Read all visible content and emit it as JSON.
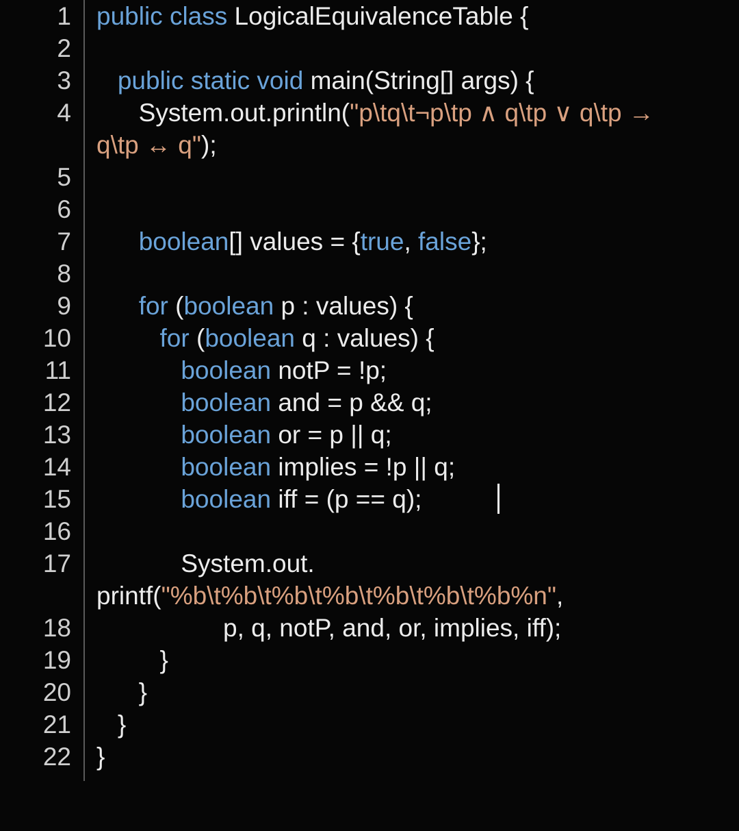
{
  "editor": {
    "colors": {
      "background": "#060606",
      "keyword": "#6aa3d9",
      "string": "#d9a07f",
      "text": "#ececec",
      "line_number": "#cfcfcf"
    },
    "lines": [
      {
        "num": "1",
        "segments": [
          {
            "t": "public class",
            "c": "kw"
          },
          {
            "t": " LogicalEquivalenceTable {",
            "c": "plain"
          }
        ]
      },
      {
        "num": "2",
        "segments": []
      },
      {
        "num": "3",
        "segments": [
          {
            "t": "   ",
            "c": "plain"
          },
          {
            "t": "public static void",
            "c": "kw"
          },
          {
            "t": " main(String[] args) {",
            "c": "plain"
          }
        ]
      },
      {
        "num": "4",
        "segments": [
          {
            "t": "      System.out.println(",
            "c": "plain"
          },
          {
            "t": "\"p\\tq\\t¬p\\tp ∧ q\\tp ∨ q\\tp →",
            "c": "str"
          }
        ]
      },
      {
        "num": "",
        "segments": [
          {
            "t": "q\\tp ↔ q\"",
            "c": "str"
          },
          {
            "t": ");",
            "c": "plain"
          }
        ]
      },
      {
        "num": "5",
        "segments": []
      },
      {
        "num": "6",
        "segments": []
      },
      {
        "num": "7",
        "segments": [
          {
            "t": "      ",
            "c": "plain"
          },
          {
            "t": "boolean",
            "c": "kw"
          },
          {
            "t": "[] values = {",
            "c": "plain"
          },
          {
            "t": "true",
            "c": "kw"
          },
          {
            "t": ", ",
            "c": "plain"
          },
          {
            "t": "false",
            "c": "kw"
          },
          {
            "t": "};",
            "c": "plain"
          }
        ]
      },
      {
        "num": "8",
        "segments": []
      },
      {
        "num": "9",
        "segments": [
          {
            "t": "      ",
            "c": "plain"
          },
          {
            "t": "for",
            "c": "kw"
          },
          {
            "t": " (",
            "c": "plain"
          },
          {
            "t": "boolean",
            "c": "kw"
          },
          {
            "t": " p : values) {",
            "c": "plain"
          }
        ]
      },
      {
        "num": "10",
        "segments": [
          {
            "t": "         ",
            "c": "plain"
          },
          {
            "t": "for",
            "c": "kw"
          },
          {
            "t": " (",
            "c": "plain"
          },
          {
            "t": "boolean",
            "c": "kw"
          },
          {
            "t": " q : values) {",
            "c": "plain"
          }
        ]
      },
      {
        "num": "11",
        "segments": [
          {
            "t": "            ",
            "c": "plain"
          },
          {
            "t": "boolean",
            "c": "kw"
          },
          {
            "t": " notP = !p;",
            "c": "plain"
          }
        ]
      },
      {
        "num": "12",
        "segments": [
          {
            "t": "            ",
            "c": "plain"
          },
          {
            "t": "boolean",
            "c": "kw"
          },
          {
            "t": " and = p && q;",
            "c": "plain"
          }
        ]
      },
      {
        "num": "13",
        "segments": [
          {
            "t": "            ",
            "c": "plain"
          },
          {
            "t": "boolean",
            "c": "kw"
          },
          {
            "t": " or = p || q;",
            "c": "plain"
          }
        ]
      },
      {
        "num": "14",
        "segments": [
          {
            "t": "            ",
            "c": "plain"
          },
          {
            "t": "boolean",
            "c": "kw"
          },
          {
            "t": " implies = !p || q;",
            "c": "plain"
          }
        ]
      },
      {
        "num": "15",
        "segments": [
          {
            "t": "            ",
            "c": "plain"
          },
          {
            "t": "boolean",
            "c": "kw"
          },
          {
            "t": " iff = (p == q);",
            "c": "plain"
          }
        ]
      },
      {
        "num": "16",
        "segments": []
      },
      {
        "num": "17",
        "segments": [
          {
            "t": "            System.out.",
            "c": "plain"
          }
        ]
      },
      {
        "num": "",
        "segments": [
          {
            "t": "printf(",
            "c": "plain"
          },
          {
            "t": "\"%b\\t%b\\t%b\\t%b\\t%b\\t%b\\t%b%n\"",
            "c": "str"
          },
          {
            "t": ",",
            "c": "plain"
          }
        ]
      },
      {
        "num": "18",
        "segments": [
          {
            "t": "                  p, q, notP, and, or, implies, iff);",
            "c": "plain"
          }
        ]
      },
      {
        "num": "19",
        "segments": [
          {
            "t": "         }",
            "c": "plain"
          }
        ]
      },
      {
        "num": "20",
        "segments": [
          {
            "t": "      }",
            "c": "plain"
          }
        ]
      },
      {
        "num": "21",
        "segments": [
          {
            "t": "   }",
            "c": "plain"
          }
        ]
      },
      {
        "num": "22",
        "segments": [
          {
            "t": "}",
            "c": "plain"
          }
        ]
      }
    ]
  }
}
